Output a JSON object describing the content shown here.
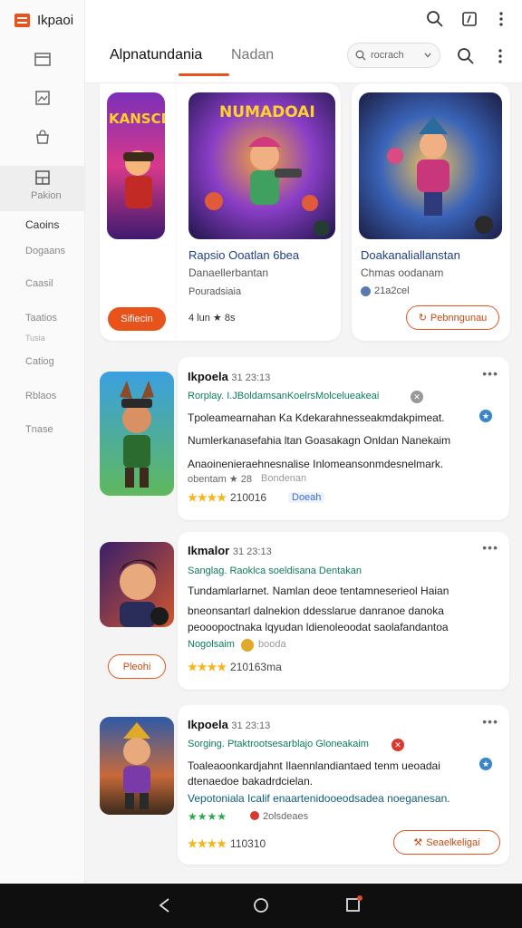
{
  "app": {
    "brand": "Ikpaoi"
  },
  "sidebar": {
    "items": [
      {
        "label": "Pakion"
      },
      {
        "label": "Caoins"
      },
      {
        "label": "Dogaans"
      },
      {
        "label": "Caasil"
      },
      {
        "label": "Taatios"
      },
      {
        "label": "Tusia"
      },
      {
        "label": "Catiog"
      },
      {
        "label": "Rblaos"
      },
      {
        "label": "Tnase"
      }
    ]
  },
  "header": {
    "tabs": [
      {
        "label": "Alpnatundania"
      },
      {
        "label": "Nadan"
      }
    ],
    "search_label": "rocrach"
  },
  "featured": [
    {
      "badge": "KANSCD",
      "button": "Sifiecin"
    },
    {
      "badge": "NUMADOAI",
      "title": "Rapsio Ooatlan 6bea",
      "line1": "Danaellerbantan",
      "line2": "Pouradsiaia",
      "rating": "4 lun ★ 8s"
    },
    {
      "title": "Doakanaliallanstan",
      "line1": "Chmas oodanam",
      "line2": "21a2cel",
      "button": "Pebnngunau"
    }
  ],
  "list": [
    {
      "title": "Ikpoela",
      "time": "31 23:13",
      "meta": "Rorplay. I.JBoldamsanKoelrsMolcelueakeai",
      "text1": "Tpoleamearnahan Ka Kdekarahnesseakmdakpimeat.",
      "text2": "Numlerkanasefahia ltan Goasakagn Onldan Nanekaim",
      "text3": "Anaoinenieraehnesnalise Inlomeansonmdesnelmark.",
      "small": "obentam ★ 28",
      "small2": "Bondenan",
      "stars": "★★★★",
      "count": "210016",
      "tag": "Doeah"
    },
    {
      "title": "Ikmalor",
      "time": "31 23:13",
      "meta": "Sanglag. Raoklca soeldisana Dentakan",
      "text1": "Tundamlarlarnet. Namlan deoe tentamneserieol Haian",
      "text2": "bneonsantarl dalnekion ddesslarue danranoe danoka",
      "text3": "peooopoctnaka lqyudan ldienoleoodat saolafandantoa",
      "small": "Nogolsaim",
      "small2": "booda",
      "stars": "★★★★",
      "count": "210163ma",
      "button": "Pleohi"
    },
    {
      "title": "Ikpoela",
      "time": "31 23:13",
      "meta": "Sorging. Ptaktrootsesarblajo Gloneakaim",
      "text1": "Toaleaoonkardjahnt Ilaennlandiantaed tenm ueoadai",
      "text2": "dtenaedoe bakadrdcielan.",
      "text3": "Vepotoniala Icalif enaartenidooeodsadea noeganesan.",
      "small": "2olsdeaes",
      "stars": "★★★★",
      "green_stars": "★★★★",
      "count": "110310",
      "button": "Seaelkeligai"
    }
  ],
  "colors": {
    "accent": "#e8531c",
    "link": "#1f3e88",
    "meta": "#0d7c59",
    "star": "#f6b51c"
  }
}
